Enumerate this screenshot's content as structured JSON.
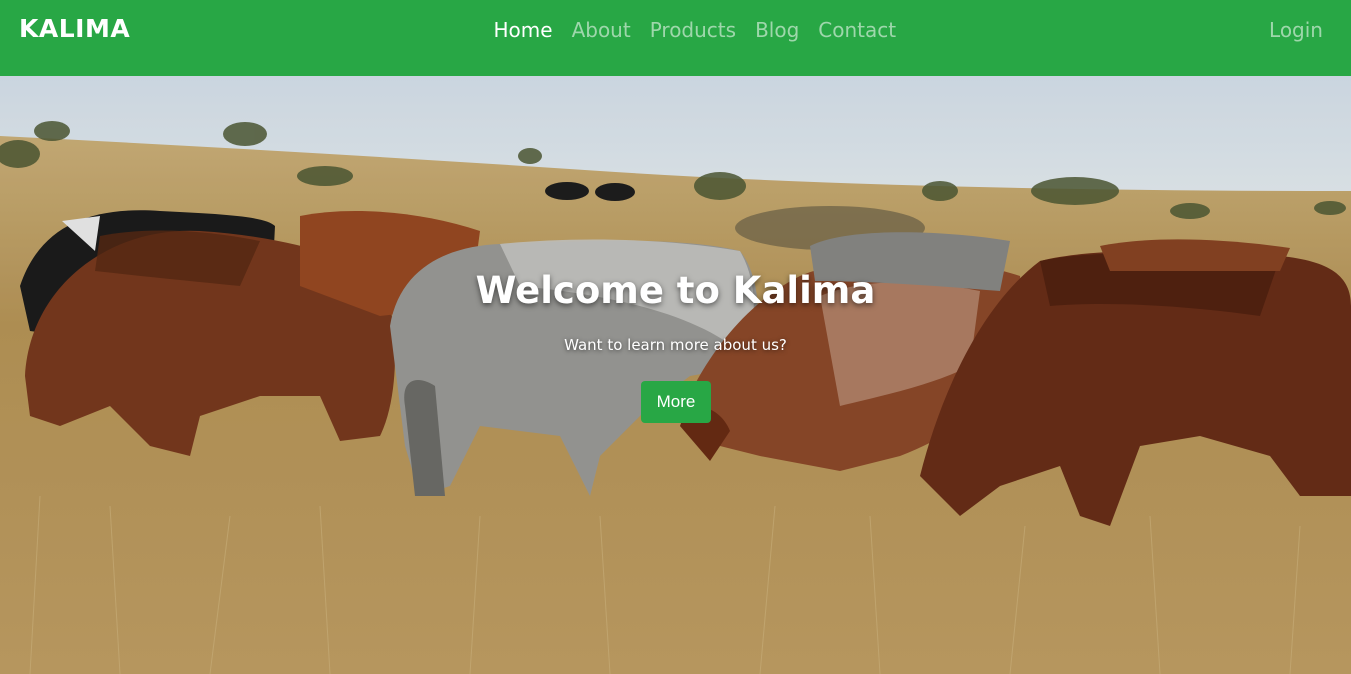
{
  "brand": "KALIMA",
  "nav": {
    "items": [
      {
        "label": "Home",
        "active": true
      },
      {
        "label": "About",
        "active": false
      },
      {
        "label": "Products",
        "active": false
      },
      {
        "label": "Blog",
        "active": false
      },
      {
        "label": "Contact",
        "active": false
      }
    ],
    "login": "Login"
  },
  "hero": {
    "title": "Welcome to Kalima",
    "subtitle": "Want to learn more about us?",
    "button": "More"
  },
  "colors": {
    "primary": "#28a745",
    "text_on_primary": "#ffffff"
  }
}
